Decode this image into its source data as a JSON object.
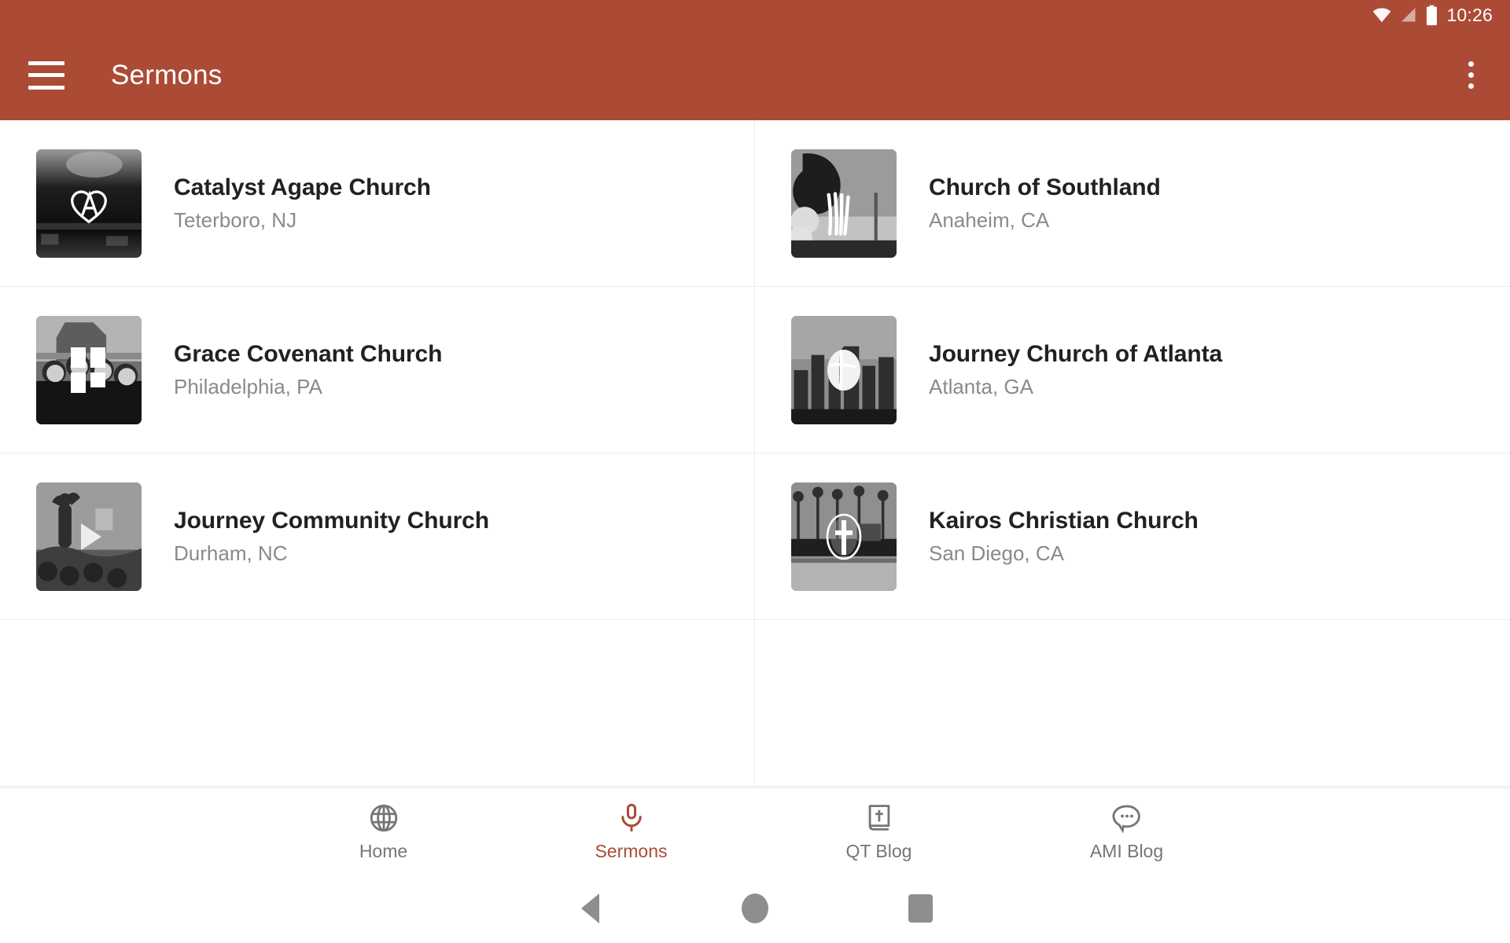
{
  "status_bar": {
    "time": "10:26",
    "icons": [
      "wifi-icon",
      "cellular-signal-icon",
      "battery-icon"
    ]
  },
  "toolbar": {
    "menu_icon": "hamburger-menu-icon",
    "title": "Sermons",
    "overflow_icon": "more-vertical-icon",
    "background_color": "#AB4B36",
    "text_color": "#FFFFFF"
  },
  "colors": {
    "accent": "#A84C37",
    "toolbar": "#AB4B36",
    "primary_text": "#212121",
    "secondary_text": "#8A8A8A",
    "divider": "#ECECEC"
  },
  "churches": [
    {
      "name": "Catalyst Agape Church",
      "location": "Teterboro, NJ",
      "thumbnail": "church-photo-thumbnail",
      "logo": "agape-a-heart-logo"
    },
    {
      "name": "Church of Southland",
      "location": "Anaheim, CA",
      "thumbnail": "church-photo-thumbnail",
      "logo": "southland-brush-logo"
    },
    {
      "name": "Grace Covenant Church",
      "location": "Philadelphia, PA",
      "thumbnail": "church-photo-thumbnail",
      "logo": "grace-window-cross-logo"
    },
    {
      "name": "Journey Church of Atlanta",
      "location": "Atlanta, GA",
      "thumbnail": "church-photo-thumbnail",
      "logo": "journey-circle-cross-logo"
    },
    {
      "name": "Journey Community Church",
      "location": "Durham, NC",
      "thumbnail": "church-photo-thumbnail",
      "logo": "play-button-overlay"
    },
    {
      "name": "Kairos Christian Church",
      "location": "San Diego, CA",
      "thumbnail": "church-photo-thumbnail",
      "logo": "kairos-oval-cross-logo"
    }
  ],
  "bottom_nav": {
    "items": [
      {
        "label": "Home",
        "icon": "globe-icon",
        "active": false
      },
      {
        "label": "Sermons",
        "icon": "microphone-icon",
        "active": true
      },
      {
        "label": "QT Blog",
        "icon": "bible-cross-icon",
        "active": false
      },
      {
        "label": "AMI Blog",
        "icon": "speech-bubble-icon",
        "active": false
      }
    ]
  },
  "system_nav": {
    "back": "back-triangle-icon",
    "home": "home-circle-icon",
    "recents": "recents-square-icon"
  }
}
